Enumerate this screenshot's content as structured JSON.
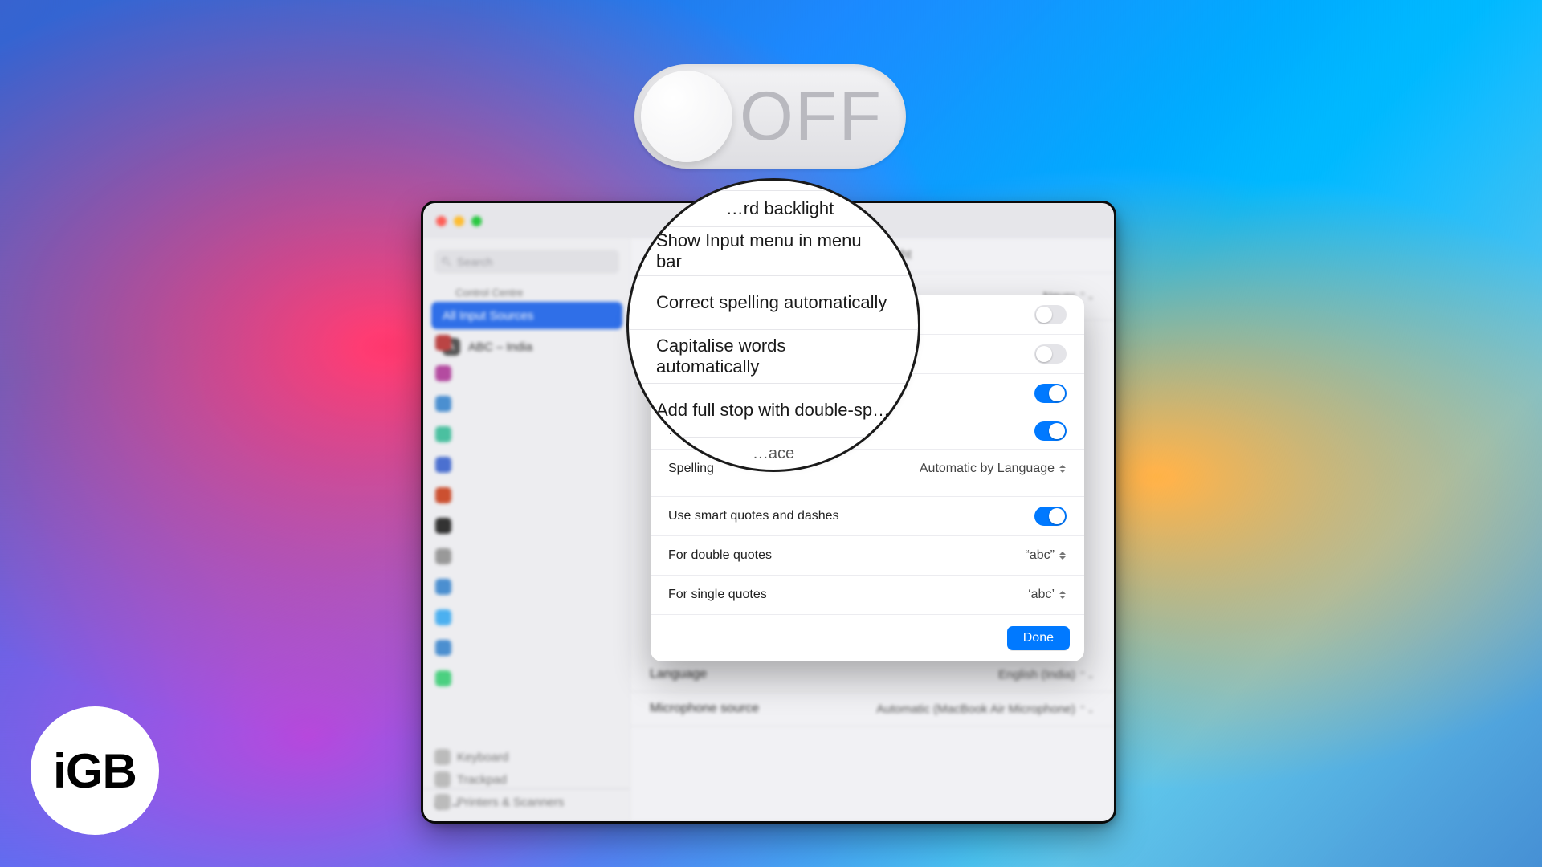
{
  "logo_text": "iGB",
  "off_toggle": {
    "label": "OFF"
  },
  "window": {
    "title": "Keyboard",
    "search_placeholder": "Search",
    "sidebar_header": "Control Centre",
    "source_all": "All Input Sources",
    "source_abc": "ABC – India",
    "bottom_items": [
      "Keyboard",
      "Trackpad",
      "Printers & Scanners"
    ],
    "add": "+",
    "remove": "−",
    "rows": {
      "backlight": "…rd backlight",
      "lang_label": "Language",
      "lang_value": "English (India)",
      "mic_label": "Microphone source",
      "mic_value": "Automatic (MacBook Air Microphone)",
      "never": "Never"
    }
  },
  "magnifier": {
    "row0": "Show Input menu in menu bar",
    "row1": "Correct spelling automatically",
    "row2": "Capitalise words automatically",
    "row3": "Add full stop with double-sp…",
    "row_partial": "…ace"
  },
  "sheet": {
    "row1_label": "Correct spelling automatically",
    "row2_spelling": "Spelling",
    "row2_value": "Automatic by Language",
    "row3_label": "Use smart quotes and dashes",
    "row4_label": "For double quotes",
    "row4_value": "“abc”",
    "row5_label": "For single quotes",
    "row5_value": "‘abc’",
    "done": "Done"
  },
  "switch_state": {
    "correct_spelling": false,
    "capitalise": false,
    "full_stop_1": true,
    "full_stop_2": true,
    "smart_quotes": true
  }
}
